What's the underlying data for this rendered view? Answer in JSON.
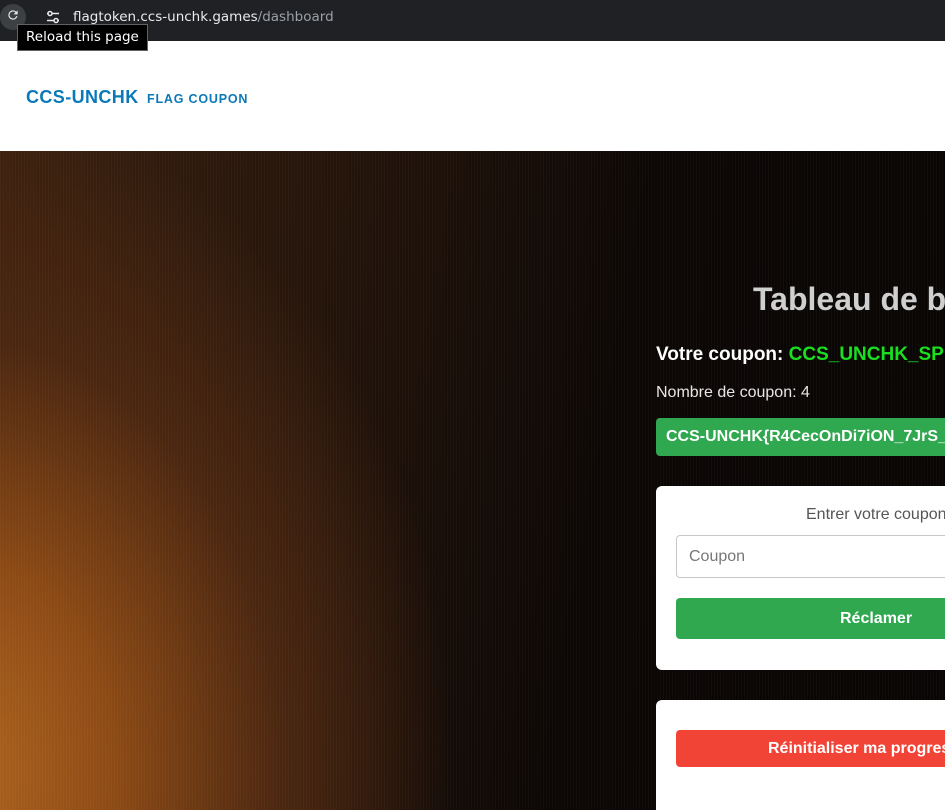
{
  "browser": {
    "url_domain": "flagtoken.ccs-unchk.games",
    "url_path": "/dashboard",
    "tooltip": "Reload this page"
  },
  "header": {
    "brand_name": "CCS-UNCHK",
    "brand_sub": "FLAG COUPON"
  },
  "dashboard": {
    "title": "Tableau de b",
    "coupon_label": "Votre coupon:",
    "coupon_code": "CCS_UNCHK_SPE",
    "count_label": "Nombre de coupon: 4",
    "flag": "CCS-UNCHK{R4CecOnDi7iON_7JrS_"
  },
  "claim_form": {
    "label": "Entrer votre coupon",
    "input_placeholder": "Coupon",
    "input_value": "",
    "button_label": "Réclamer"
  },
  "reset": {
    "button_label": "Réinitialiser ma progres"
  },
  "colors": {
    "brand": "#0b79b8",
    "coupon_code": "#19e01f",
    "success": "#2fa84f",
    "danger": "#f14336"
  },
  "icons": {
    "reload": "reload-icon",
    "site_info": "tune-icon"
  }
}
